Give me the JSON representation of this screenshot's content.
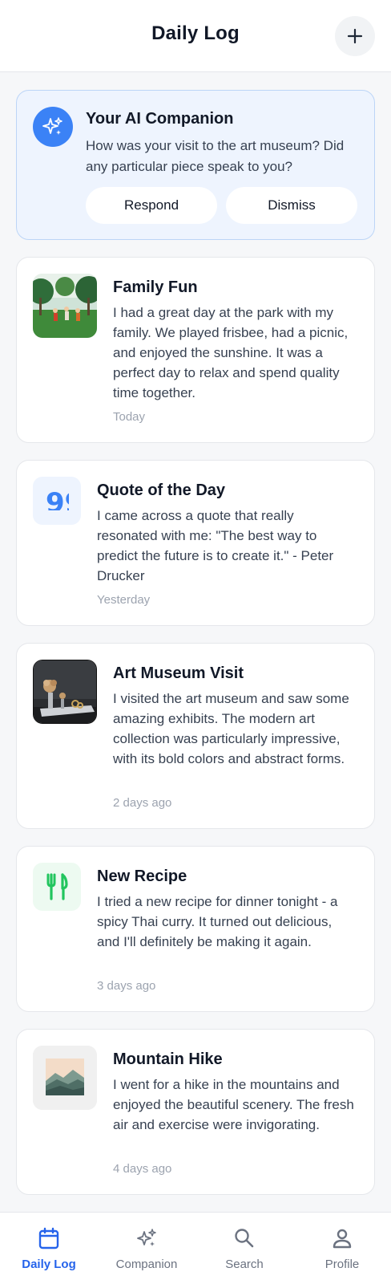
{
  "header": {
    "title": "Daily Log",
    "add_icon": "plus-icon"
  },
  "ai_companion": {
    "icon": "sparkles-icon",
    "title": "Your AI Companion",
    "message": "How was your visit to the art museum? Did any particular piece speak to you?",
    "respond_label": "Respond",
    "dismiss_label": "Dismiss"
  },
  "entries": [
    {
      "title": "Family Fun",
      "body": "I had a great day at the park with my family. We played frisbee, had a picnic, and enjoyed the sunshine. It was a perfect day to relax and spend quality time together.",
      "date": "Today",
      "media": "photo"
    },
    {
      "title": "Quote of the Day",
      "body": "I came across a quote that really resonated with me: \"The best way to predict the future is to create it.\" - Peter Drucker",
      "date": "Yesterday",
      "media": "quote-icon"
    },
    {
      "title": "Art Museum Visit",
      "body": "I visited the art museum and saw some amazing exhibits. The modern art collection was particularly impressive, with its bold colors and abstract forms.",
      "date": "2 days ago",
      "media": "photo"
    },
    {
      "title": "New Recipe",
      "body": "I tried a new recipe for dinner tonight - a spicy Thai curry. It turned out delicious, and I'll definitely be making it again.",
      "date": "3 days ago",
      "media": "utensils-icon"
    },
    {
      "title": "Mountain Hike",
      "body": "I went for a hike in the mountains and enjoyed the beautiful scenery. The fresh air and exercise were invigorating.",
      "date": "4 days ago",
      "media": "photo"
    }
  ],
  "tabbar": {
    "tabs": [
      {
        "label": "Daily Log",
        "icon": "calendar-icon",
        "active": true
      },
      {
        "label": "Companion",
        "icon": "sparkles-icon",
        "active": false
      },
      {
        "label": "Search",
        "icon": "search-icon",
        "active": false
      },
      {
        "label": "Profile",
        "icon": "user-icon",
        "active": false
      }
    ]
  },
  "colors": {
    "accent": "#3b82f6",
    "active_tab": "#2563eb",
    "ai_card_bg": "#eef4fe",
    "quote_icon": "#3b82f6",
    "recipe_icon": "#22c55e"
  }
}
